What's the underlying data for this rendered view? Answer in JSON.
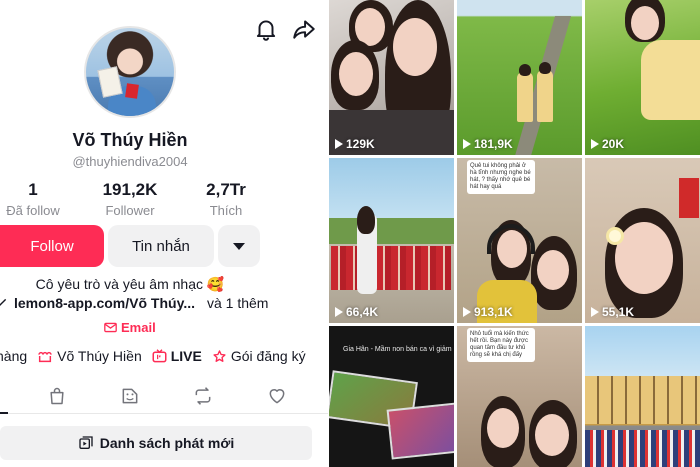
{
  "profile": {
    "name": "Võ Thúy Hiền",
    "handle": "@thuyhiendiva2004",
    "stats": [
      {
        "value": "1",
        "label": "Đã follow"
      },
      {
        "value": "191,2K",
        "label": "Follower"
      },
      {
        "value": "2,7Tr",
        "label": "Thích"
      }
    ],
    "buttons": {
      "follow": "Follow",
      "message": "Tin nhắn"
    },
    "bio": "Cô yêu trò và yêu âm nhạc 🥰",
    "link": "lemon8-app.com/Võ Thúy...",
    "link_more": "và 1 thêm",
    "email_label": "Email",
    "shortcuts": [
      "hàng",
      "Võ Thúy Hiền",
      "LIVE",
      "Gói đăng ký"
    ],
    "playlist_label": "Danh sách phát mới",
    "accent_color": "#fe2c55"
  },
  "videos": [
    {
      "views": "129K"
    },
    {
      "views": "181,9K"
    },
    {
      "views": "20K"
    },
    {
      "views": "66,4K"
    },
    {
      "views": "913,1K"
    },
    {
      "views": "55,1K"
    },
    {
      "views": ""
    },
    {
      "views": ""
    },
    {
      "views": ""
    }
  ],
  "overlays": {
    "tile5": "Quê tui không phải ở hà tĩnh nhưng nghe bé hát, ? thấy nhớ quê bé hát hay quá",
    "tile7_banner": "Gia Hân - Mầm non bán ca vì giảm",
    "tile8": "Nhỏ tuổi mà kiến thức hết rồi. Bạn này được quan tâm đầu tư khủ rồng sẽ khá chị đấy"
  },
  "icons": [
    "bell-icon",
    "share-icon",
    "link-icon",
    "mail-icon",
    "shop-icon",
    "live-icon",
    "subscription-icon",
    "shopping-bag-icon",
    "tag-icon",
    "repost-icon",
    "heart-icon",
    "playlist-icon",
    "play-icon"
  ]
}
